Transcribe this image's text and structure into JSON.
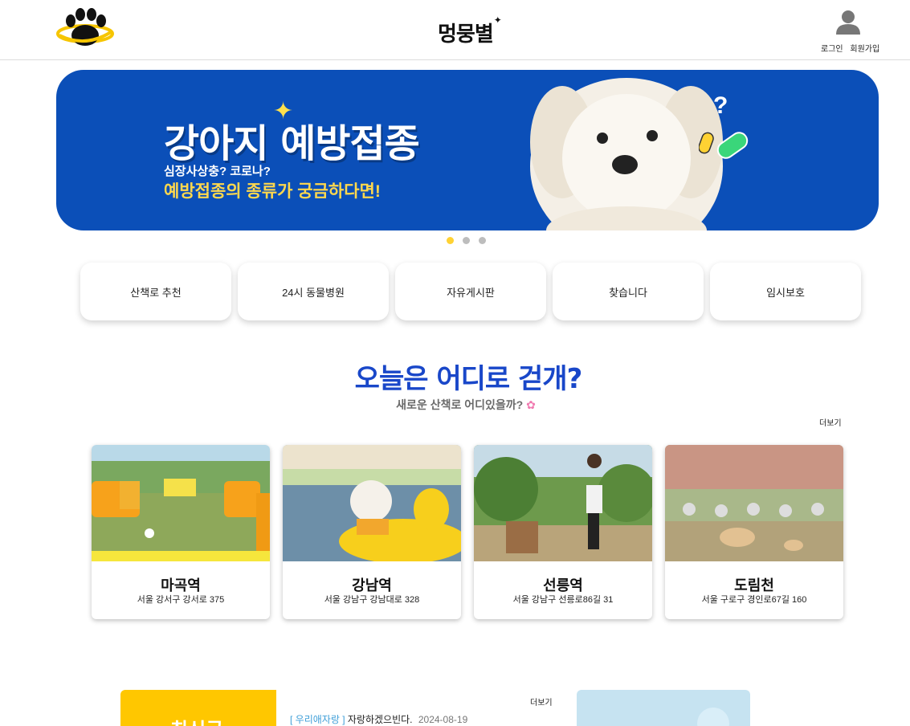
{
  "header": {
    "brand": "멍뭉별",
    "login": "로그인",
    "signup": "회원가입"
  },
  "banner": {
    "title": "강아지 예방접종",
    "subtitle1": "심장사상충? 코로나?",
    "subtitle2": "예방접종의 종류가 궁금하다면!",
    "qmark": "?"
  },
  "nav": {
    "items": [
      {
        "label": "산책로 추천"
      },
      {
        "label": "24시 동물병원"
      },
      {
        "label": "자유게시판"
      },
      {
        "label": "찾습니다"
      },
      {
        "label": "임시보호"
      }
    ]
  },
  "walk": {
    "title": "오늘은 어디로 걷개?",
    "subtitle": "새로운 산책로 어디있을까?",
    "more": "더보기",
    "places": [
      {
        "name": "마곡역",
        "address": "서울 강서구 강서로 375"
      },
      {
        "name": "강남역",
        "address": "서울 강남구 강남대로 328"
      },
      {
        "name": "선릉역",
        "address": "서울 강남구 선릉로86길 31"
      },
      {
        "name": "도림천",
        "address": "서울 구로구 경인로67길 160"
      }
    ]
  },
  "recent": {
    "title": "최신글",
    "more": "더보기",
    "posts": [
      {
        "category": "[ 우리애자랑 ]",
        "title": "자랑하겠으빈다.",
        "date": "2024-08-19"
      }
    ]
  },
  "colors": {
    "brand_blue": "#1947c9",
    "banner_bg": "#0b4fb8",
    "accent_yellow": "#ffc700",
    "dot_active": "#ffd233"
  },
  "icons": {
    "logo": "paw-planet-logo",
    "user": "user-icon",
    "flower": "flower-icon"
  },
  "carousel": {
    "active_index": 0,
    "count": 3
  }
}
